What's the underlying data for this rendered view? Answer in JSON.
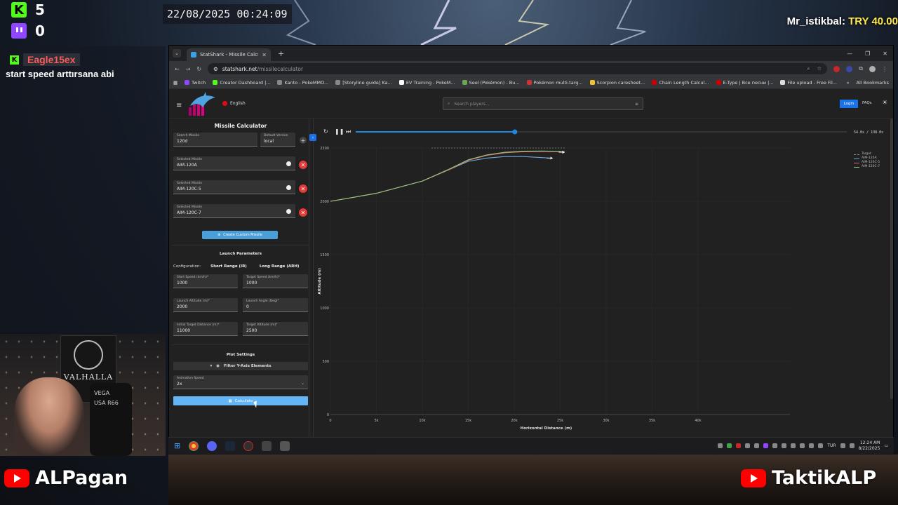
{
  "overlay": {
    "kick_count": "5",
    "twitch_count": "0",
    "datetime": "22/08/2025 00:24:09",
    "donation_user": "Mr_istikbal:",
    "donation_amount": "TRY 40.00",
    "chat_user": "Eagle15ex",
    "chat_message": "start speed arttırsana abi",
    "webcam_banner": "VALHALLA",
    "webcam_chair": "USA R66",
    "webcam_chair_brand": "VEGA",
    "yt_left": "ALPagan",
    "yt_right": "TaktikALP"
  },
  "browser": {
    "tab_title": "StatShark - Missile Calculator",
    "url_host": "statshark.net",
    "url_path": "/missilecalculator",
    "bookmarks": [
      {
        "label": "Twitch",
        "color": "#9146ff"
      },
      {
        "label": "Creator Dashboard |...",
        "color": "#53fc18"
      },
      {
        "label": "Kanto - PokeMMO...",
        "color": "#888888"
      },
      {
        "label": "[Storyline guide] Ka...",
        "color": "#888888"
      },
      {
        "label": "EV Training - PokeM...",
        "color": "#ffffff"
      },
      {
        "label": "Seel (Pokémon) - Bu...",
        "color": "#6aa84f"
      },
      {
        "label": "Pokémon multi-targ...",
        "color": "#cc3333"
      },
      {
        "label": "Scorpion caresheet...",
        "color": "#f1c232"
      },
      {
        "label": "Chain Length Calcul...",
        "color": "#cc0000"
      },
      {
        "label": "E-Type | Все песни |...",
        "color": "#cc0000"
      },
      {
        "label": "File upload - Free Fil...",
        "color": "#dddddd"
      }
    ],
    "all_bookmarks": "All Bookmarks"
  },
  "site": {
    "language": "English",
    "search_placeholder": "Search players...",
    "login": "Login",
    "faqs": "FAQs"
  },
  "calc": {
    "title": "Missile Calculator",
    "search_missile_label": "Search Missile",
    "search_missile_value": "120d",
    "default_version_label": "Default Version",
    "default_version_value": "local",
    "selected_label": "Selected Missile",
    "selected": [
      "AIM-120A",
      "AIM-120C-5",
      "AIM-120C-7"
    ],
    "create_custom": "Create Custom Missile",
    "launch_params": "Launch Parameters",
    "configuration": "Configuration:",
    "short_range": "Short Range (IR)",
    "long_range": "Long Range (ARH)",
    "fields": [
      {
        "label": "Start Speed (km/h)*",
        "value": "1000"
      },
      {
        "label": "Target Speed (km/h)*",
        "value": "1000"
      },
      {
        "label": "Launch Altitude (m)*",
        "value": "2000"
      },
      {
        "label": "Launch Angle (Deg)*",
        "value": "0"
      },
      {
        "label": "Initial Target Distance (m)*",
        "value": "11000"
      },
      {
        "label": "Target Altitude (m)*",
        "value": "2500"
      }
    ],
    "plot_settings": "Plot Settings",
    "filter_y": "Filter Y-Axis Elements",
    "anim_label": "Animation Speed",
    "anim_value": "2x",
    "calculate": "Calculate"
  },
  "player": {
    "progress": 0.4,
    "time": "54.0s / 138.0s"
  },
  "chart_data": {
    "type": "line",
    "xlabel": "Horizontal Distance (m)",
    "ylabel": "Altitude (m)",
    "xlim": [
      0,
      50000
    ],
    "ylim": [
      0,
      2500
    ],
    "x_ticks": [
      "0",
      "5k",
      "10k",
      "15k",
      "20k",
      "25k",
      "30k",
      "35k",
      "40k"
    ],
    "x_tick_values": [
      0,
      5000,
      10000,
      15000,
      20000,
      25000,
      30000,
      35000,
      40000
    ],
    "y_ticks": [
      "0",
      "500",
      "1000",
      "1500",
      "2000",
      "2500"
    ],
    "y_tick_values": [
      0,
      500,
      1000,
      1500,
      2000,
      2500
    ],
    "legend": [
      "Target",
      "AIM-120A",
      "AIM-120C-5",
      "AIM-120C-7"
    ],
    "grid": true,
    "legend_position": "top-right",
    "series": [
      {
        "name": "Target",
        "color": "#8a8a8a",
        "dashed": true,
        "x": [
          11000,
          25500
        ],
        "y": [
          2500,
          2500
        ]
      },
      {
        "name": "AIM-120A",
        "color": "#6fa8dc",
        "x": [
          0,
          5000,
          10000,
          13000,
          15000,
          17000,
          19000,
          21000,
          23000,
          24000
        ],
        "y": [
          2000,
          2075,
          2190,
          2300,
          2375,
          2405,
          2420,
          2420,
          2410,
          2405
        ]
      },
      {
        "name": "AIM-120C-5",
        "color": "#e06666",
        "x": [
          0,
          5000,
          10000,
          13000,
          15000,
          17000,
          19000,
          21000,
          23000,
          25000,
          25300
        ],
        "y": [
          2000,
          2075,
          2190,
          2300,
          2385,
          2430,
          2455,
          2465,
          2468,
          2465,
          2460
        ]
      },
      {
        "name": "AIM-120C-7",
        "color": "#93c47d",
        "x": [
          0,
          5000,
          10000,
          13000,
          15000,
          17000,
          19000,
          21000,
          23000,
          25000,
          25300
        ],
        "y": [
          2000,
          2075,
          2190,
          2305,
          2390,
          2435,
          2460,
          2470,
          2472,
          2468,
          2462
        ]
      }
    ]
  },
  "taskbar": {
    "lang": "TUR",
    "time": "12:24 AM",
    "date": "8/22/2025"
  }
}
